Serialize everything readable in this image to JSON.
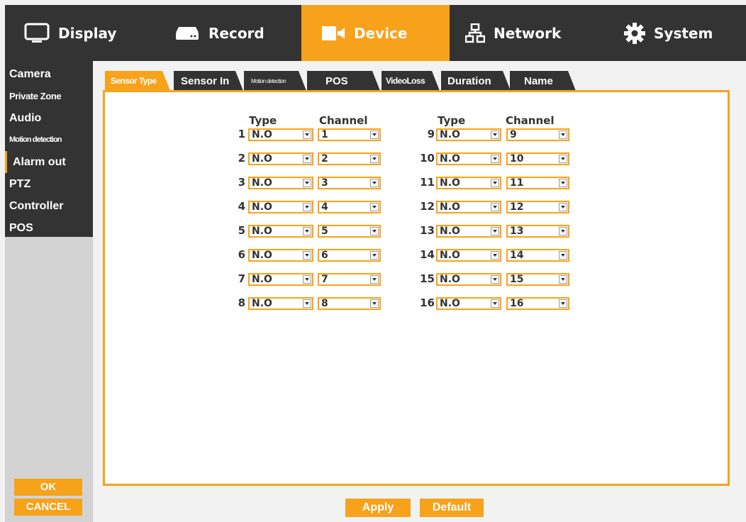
{
  "colors": {
    "accent": "#f7a21b",
    "dark": "#333333",
    "panel_bg": "#ffffff",
    "side_bg": "#d3d3d3"
  },
  "topnav": [
    {
      "label": "Display",
      "icon": "monitor-icon",
      "active": false
    },
    {
      "label": "Record",
      "icon": "recorder-icon",
      "active": false
    },
    {
      "label": "Device",
      "icon": "camera-icon",
      "active": true
    },
    {
      "label": "Network",
      "icon": "network-icon",
      "active": false
    },
    {
      "label": "System",
      "icon": "gear-icon",
      "active": false
    }
  ],
  "sidebar": {
    "items": [
      {
        "label": "Camera"
      },
      {
        "label": "Private Zone"
      },
      {
        "label": "Audio"
      },
      {
        "label": "Motion detection"
      },
      {
        "label": "Alarm out",
        "active": true
      },
      {
        "label": "PTZ"
      },
      {
        "label": "Controller"
      },
      {
        "label": "POS"
      }
    ],
    "ok_label": "OK",
    "cancel_label": "CANCEL"
  },
  "subtabs": [
    {
      "label": "Sensor Type",
      "active": true
    },
    {
      "label": "Sensor In"
    },
    {
      "label": "Motion detection"
    },
    {
      "label": "POS"
    },
    {
      "label": "VideoLoss"
    },
    {
      "label": "Duration"
    },
    {
      "label": "Name"
    }
  ],
  "table": {
    "headers": {
      "type": "Type",
      "channel": "Channel"
    },
    "rows": [
      {
        "num": "1",
        "type": "N.O",
        "channel": "1"
      },
      {
        "num": "2",
        "type": "N.O",
        "channel": "2"
      },
      {
        "num": "3",
        "type": "N.O",
        "channel": "3"
      },
      {
        "num": "4",
        "type": "N.O",
        "channel": "4"
      },
      {
        "num": "5",
        "type": "N.O",
        "channel": "5"
      },
      {
        "num": "6",
        "type": "N.O",
        "channel": "6"
      },
      {
        "num": "7",
        "type": "N.O",
        "channel": "7"
      },
      {
        "num": "8",
        "type": "N.O",
        "channel": "8"
      },
      {
        "num": "9",
        "type": "N.O",
        "channel": "9"
      },
      {
        "num": "10",
        "type": "N.O",
        "channel": "10"
      },
      {
        "num": "11",
        "type": "N.O",
        "channel": "11"
      },
      {
        "num": "12",
        "type": "N.O",
        "channel": "12"
      },
      {
        "num": "13",
        "type": "N.O",
        "channel": "13"
      },
      {
        "num": "14",
        "type": "N.O",
        "channel": "14"
      },
      {
        "num": "15",
        "type": "N.O",
        "channel": "15"
      },
      {
        "num": "16",
        "type": "N.O",
        "channel": "16"
      }
    ]
  },
  "actions": {
    "apply_label": "Apply",
    "default_label": "Default"
  }
}
